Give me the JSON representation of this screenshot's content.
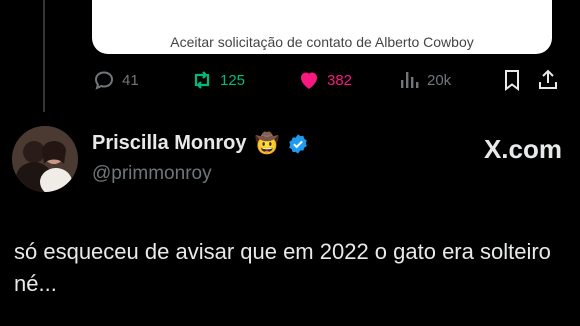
{
  "quoted": {
    "caption": "Aceitar solicitação de contato de Alberto Cowboy"
  },
  "actions": {
    "replies": "41",
    "retweets": "125",
    "likes": "382",
    "views": "20k"
  },
  "author": {
    "name": "Priscilla Monroy",
    "emoji": "🤠",
    "handle": "@primmonroy",
    "verified": true
  },
  "source": "X.com",
  "tweet": {
    "text": "só esqueceu de avisar que em 2022 o gato era solteiro né..."
  },
  "colors": {
    "background": "#000000",
    "text": "#e7e9ea",
    "muted": "#71767b",
    "retweet": "#00ba7c",
    "like": "#f91880",
    "verified": "#1d9bf0"
  }
}
